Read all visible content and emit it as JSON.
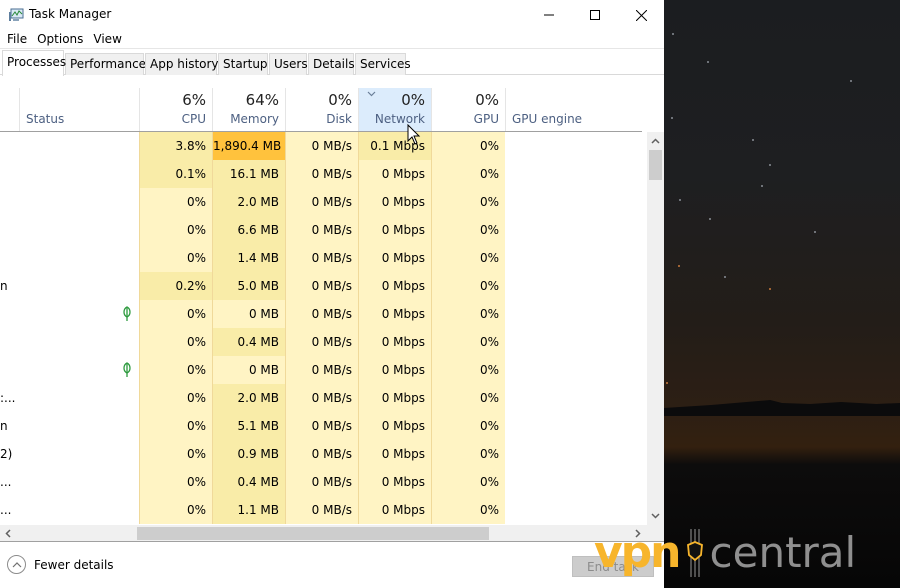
{
  "window": {
    "title": "Task Manager",
    "controls": {
      "minimize": "minimize",
      "maximize": "maximize",
      "close": "close"
    }
  },
  "menu": [
    "File",
    "Options",
    "View"
  ],
  "tabs": [
    {
      "label": "Processes",
      "active": true
    },
    {
      "label": "Performance",
      "active": false
    },
    {
      "label": "App history",
      "active": false
    },
    {
      "label": "Startup",
      "active": false
    },
    {
      "label": "Users",
      "active": false
    },
    {
      "label": "Details",
      "active": false
    },
    {
      "label": "Services",
      "active": false
    }
  ],
  "columns": {
    "status": {
      "label": "Status"
    },
    "cpu": {
      "pct": "6%",
      "label": "CPU"
    },
    "memory": {
      "pct": "64%",
      "label": "Memory"
    },
    "disk": {
      "pct": "0%",
      "label": "Disk"
    },
    "network": {
      "pct": "0%",
      "label": "Network",
      "sorted": true
    },
    "gpu": {
      "pct": "0%",
      "label": "GPU"
    },
    "gpu_engine": {
      "label": "GPU engine"
    }
  },
  "rows": [
    {
      "name": "",
      "leaf": false,
      "cpu": "3.8%",
      "memory": "1,890.4 MB",
      "disk": "0 MB/s",
      "network": "0.1 Mbps",
      "gpu": "0%",
      "heat": {
        "cpu": 2,
        "memory": 4,
        "disk": 1,
        "network": 2,
        "gpu": 1
      }
    },
    {
      "name": "",
      "leaf": false,
      "cpu": "0.1%",
      "memory": "16.1 MB",
      "disk": "0 MB/s",
      "network": "0 Mbps",
      "gpu": "0%",
      "heat": {
        "cpu": 2,
        "memory": 2,
        "disk": 1,
        "network": 1,
        "gpu": 1
      }
    },
    {
      "name": "",
      "leaf": false,
      "cpu": "0%",
      "memory": "2.0 MB",
      "disk": "0 MB/s",
      "network": "0 Mbps",
      "gpu": "0%",
      "heat": {
        "cpu": 1,
        "memory": 2,
        "disk": 1,
        "network": 1,
        "gpu": 1
      }
    },
    {
      "name": "",
      "leaf": false,
      "cpu": "0%",
      "memory": "6.6 MB",
      "disk": "0 MB/s",
      "network": "0 Mbps",
      "gpu": "0%",
      "heat": {
        "cpu": 1,
        "memory": 2,
        "disk": 1,
        "network": 1,
        "gpu": 1
      }
    },
    {
      "name": "",
      "leaf": false,
      "cpu": "0%",
      "memory": "1.4 MB",
      "disk": "0 MB/s",
      "network": "0 Mbps",
      "gpu": "0%",
      "heat": {
        "cpu": 1,
        "memory": 2,
        "disk": 1,
        "network": 1,
        "gpu": 1
      }
    },
    {
      "name": "n",
      "leaf": false,
      "cpu": "0.2%",
      "memory": "5.0 MB",
      "disk": "0 MB/s",
      "network": "0 Mbps",
      "gpu": "0%",
      "heat": {
        "cpu": 2,
        "memory": 2,
        "disk": 1,
        "network": 1,
        "gpu": 1
      }
    },
    {
      "name": "",
      "leaf": true,
      "cpu": "0%",
      "memory": "0 MB",
      "disk": "0 MB/s",
      "network": "0 Mbps",
      "gpu": "0%",
      "heat": {
        "cpu": 1,
        "memory": 1,
        "disk": 1,
        "network": 1,
        "gpu": 1
      }
    },
    {
      "name": "",
      "leaf": false,
      "cpu": "0%",
      "memory": "0.4 MB",
      "disk": "0 MB/s",
      "network": "0 Mbps",
      "gpu": "0%",
      "heat": {
        "cpu": 1,
        "memory": 2,
        "disk": 1,
        "network": 1,
        "gpu": 1
      }
    },
    {
      "name": "",
      "leaf": true,
      "cpu": "0%",
      "memory": "0 MB",
      "disk": "0 MB/s",
      "network": "0 Mbps",
      "gpu": "0%",
      "heat": {
        "cpu": 1,
        "memory": 1,
        "disk": 1,
        "network": 1,
        "gpu": 1
      }
    },
    {
      "name": ":...",
      "leaf": false,
      "cpu": "0%",
      "memory": "2.0 MB",
      "disk": "0 MB/s",
      "network": "0 Mbps",
      "gpu": "0%",
      "heat": {
        "cpu": 1,
        "memory": 2,
        "disk": 1,
        "network": 1,
        "gpu": 1
      }
    },
    {
      "name": "n",
      "leaf": false,
      "cpu": "0%",
      "memory": "5.1 MB",
      "disk": "0 MB/s",
      "network": "0 Mbps",
      "gpu": "0%",
      "heat": {
        "cpu": 1,
        "memory": 2,
        "disk": 1,
        "network": 1,
        "gpu": 1
      }
    },
    {
      "name": "2)",
      "leaf": false,
      "cpu": "0%",
      "memory": "0.9 MB",
      "disk": "0 MB/s",
      "network": "0 Mbps",
      "gpu": "0%",
      "heat": {
        "cpu": 1,
        "memory": 2,
        "disk": 1,
        "network": 1,
        "gpu": 1
      }
    },
    {
      "name": "...",
      "leaf": false,
      "cpu": "0%",
      "memory": "0.4 MB",
      "disk": "0 MB/s",
      "network": "0 Mbps",
      "gpu": "0%",
      "heat": {
        "cpu": 1,
        "memory": 2,
        "disk": 1,
        "network": 1,
        "gpu": 1
      }
    },
    {
      "name": "...",
      "leaf": false,
      "cpu": "0%",
      "memory": "1.1 MB",
      "disk": "0 MB/s",
      "network": "0 Mbps",
      "gpu": "0%",
      "heat": {
        "cpu": 1,
        "memory": 2,
        "disk": 1,
        "network": 1,
        "gpu": 1
      }
    }
  ],
  "heat_colors": {
    "1": "#fff4c4",
    "2": "#f9eca8",
    "3": "#ffd27a",
    "4": "#ffc23d"
  },
  "footer": {
    "fewer_details": "Fewer details",
    "end_task": "End task"
  },
  "watermark": {
    "left": "vpn",
    "right": "central",
    "accent": "#f7b52c"
  }
}
